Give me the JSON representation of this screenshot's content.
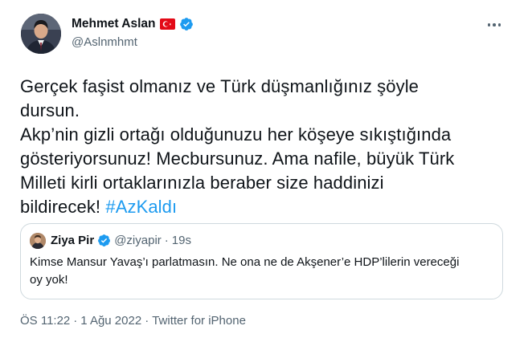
{
  "author": {
    "name": "Mehmet Aslan",
    "handle": "@Aslnmhmt"
  },
  "tweet": {
    "lines": [
      "Gerçek faşist olmanız ve Türk düşmanlığınız şöyle",
      "dursun.",
      "Akp’nin gizli ortağı olduğunuzu her köşeye sıkıştığında",
      "gösteriyorsunuz! Mecbursunuz. Ama nafile, büyük Türk",
      "Milleti kirli ortaklarınızla beraber size haddinizi",
      "bildirecek! "
    ],
    "hashtag": "#AzKaldı"
  },
  "quoted": {
    "name": "Ziya Pir",
    "handle": "@ziyapir",
    "separator": "·",
    "time": "19s",
    "lines": [
      "Kimse Mansur Yavaş’ı parlatmasın. Ne ona ne de Akşener’e HDP’lilerin vereceği",
      "oy yok!"
    ]
  },
  "footer": {
    "time": "ÖS 11:22",
    "sep1": "·",
    "date": "1 Ağu 2022",
    "sep2": "·",
    "source": "Twitter for iPhone"
  },
  "colors": {
    "text": "#0f1419",
    "secondary": "#536471",
    "link": "#1d9bf0",
    "verified": "#1d9bf0",
    "border": "#cfd9de",
    "flag": "#e30a17"
  },
  "icons": {
    "verified": "verified-badge-icon",
    "flag": "turkey-flag-icon",
    "more": "more-options-icon"
  }
}
